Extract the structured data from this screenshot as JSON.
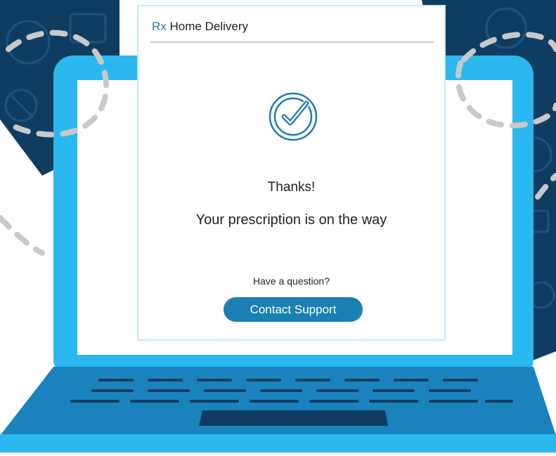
{
  "app": {
    "brand_prefix": "Rx",
    "brand_name": "Home Delivery"
  },
  "confirmation": {
    "icon": "check-circle-icon",
    "heading": "Thanks!",
    "message": "Your prescription is on the way"
  },
  "support": {
    "question": "Have a question?",
    "button_label": "Contact Support"
  },
  "colors": {
    "accent": "#1a80b3",
    "laptop_screen_bezel": "#2bb8ee",
    "laptop_base": "#1a83bd",
    "background_pattern": "#0f3d62"
  }
}
